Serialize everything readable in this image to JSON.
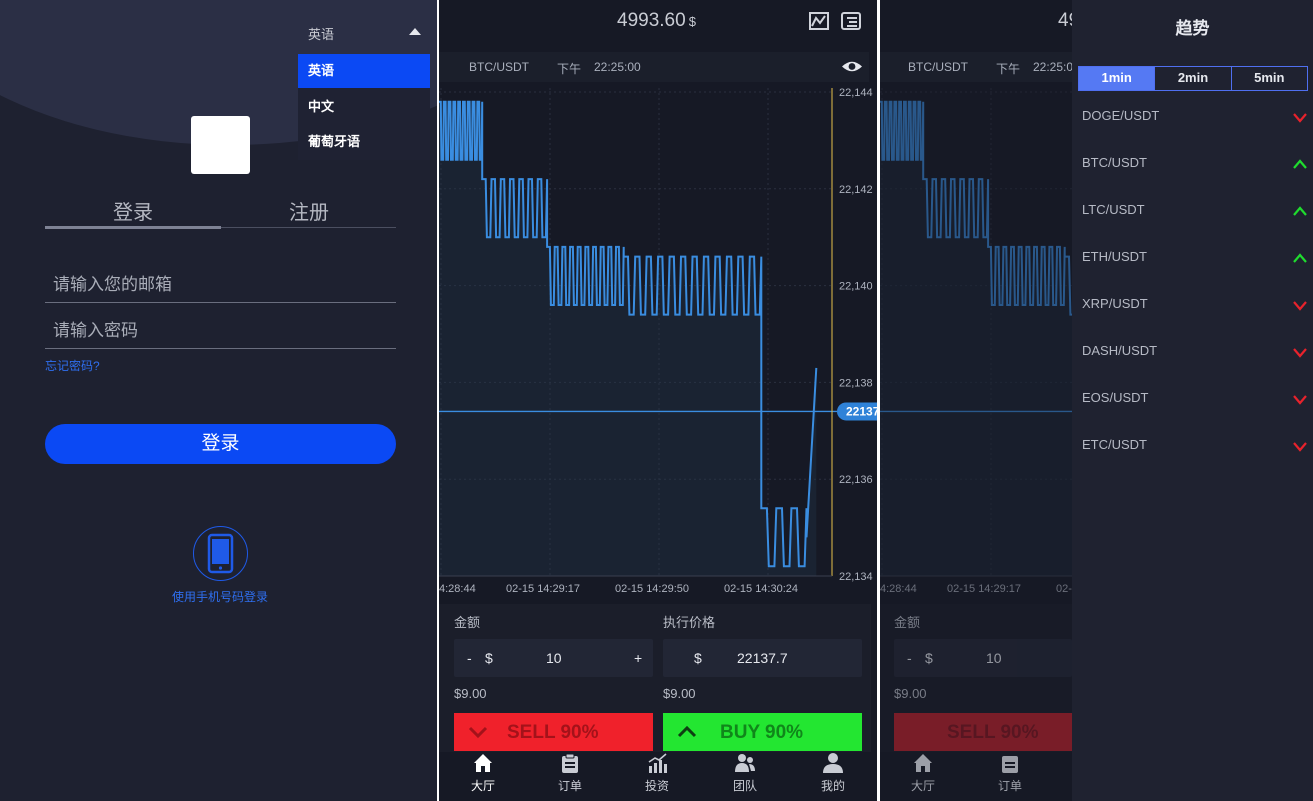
{
  "login": {
    "language_selected": "英语",
    "language_options": [
      "英语",
      "中文",
      "葡萄牙语"
    ],
    "tabs": [
      "登录",
      "注册"
    ],
    "email_placeholder": "请输入您的邮箱",
    "password_placeholder": "请输入密码",
    "forgot_password": "忘记密码?",
    "login_button": "登录",
    "phone_login": "使用手机号码登录"
  },
  "trading": {
    "balance": "4993.60",
    "currency_symbol": "$",
    "pair": "BTC/USDT",
    "time_period": "下午",
    "time": "22:25:00",
    "current_price_tag": "22137",
    "amount_label": "金额",
    "strike_label": "执行价格",
    "amount_minus": "-",
    "amount_plus": "+",
    "amount_value": "10",
    "strike_value": "22137.7",
    "amount_sub": "$9.00",
    "strike_sub": "$9.00",
    "sell_label": "SELL 90%",
    "buy_label": "BUY 90%",
    "nav": [
      "大厅",
      "订单",
      "投资",
      "团队",
      "我的"
    ]
  },
  "chart_data": {
    "type": "line",
    "x_tick_labels": [
      "4:28:44",
      "02-15 14:29:17",
      "02-15 14:29:50",
      "02-15 14:30:24"
    ],
    "y_tick_labels": [
      "22,144",
      "22,142",
      "22,140",
      "22,138",
      "22,136",
      "22,134"
    ],
    "ylim": [
      22134,
      22144
    ],
    "current_price": 22137,
    "segments": [
      {
        "from": 0.0,
        "to": 0.11,
        "level": 22143.2,
        "oscillation": 0.6,
        "cycles": 9
      },
      {
        "from": 0.11,
        "to": 0.275,
        "level": 22141.6,
        "oscillation": 0.6,
        "cycles": 7
      },
      {
        "from": 0.275,
        "to": 0.47,
        "level": 22140.2,
        "oscillation": 0.6,
        "cycles": 10
      },
      {
        "from": 0.47,
        "to": 0.82,
        "level": 22140.0,
        "oscillation": 0.6,
        "cycles": 12
      },
      {
        "from": 0.82,
        "to": 0.935,
        "level": 22134.8,
        "oscillation": 0.6,
        "cycles": 3
      }
    ],
    "end_value": 22138.3,
    "line_color": "#3a8de0"
  },
  "trend": {
    "title": "趋势",
    "intervals": [
      "1min",
      "2min",
      "5min"
    ],
    "active_interval": "1min",
    "items": [
      {
        "pair": "DOGE/USDT",
        "direction": "down"
      },
      {
        "pair": "BTC/USDT",
        "direction": "up"
      },
      {
        "pair": "LTC/USDT",
        "direction": "up"
      },
      {
        "pair": "ETH/USDT",
        "direction": "up"
      },
      {
        "pair": "XRP/USDT",
        "direction": "down"
      },
      {
        "pair": "DASH/USDT",
        "direction": "down"
      },
      {
        "pair": "EOS/USDT",
        "direction": "down"
      },
      {
        "pair": "ETC/USDT",
        "direction": "down"
      }
    ],
    "up_color": "#1fdc2e",
    "down_color": "#e8222c"
  }
}
